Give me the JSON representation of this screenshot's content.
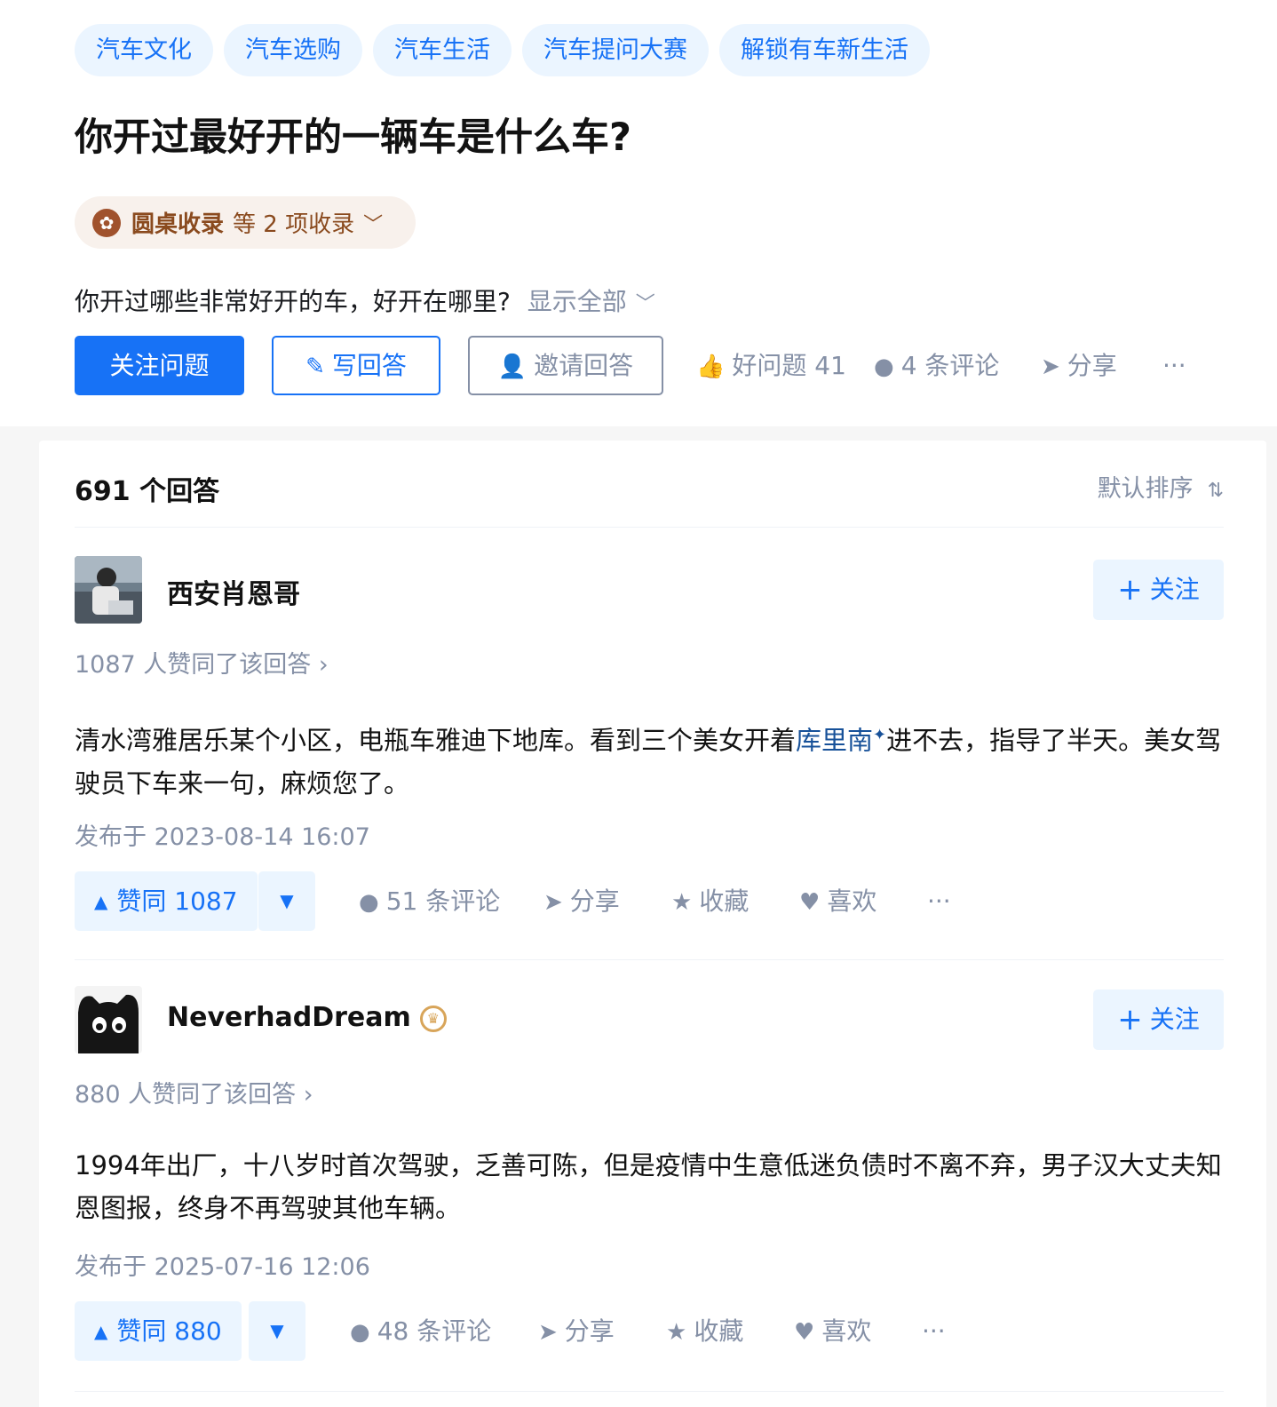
{
  "topics": [
    "汽车文化",
    "汽车选购",
    "汽车生活",
    "汽车提问大赛",
    "解锁有车新生活"
  ],
  "question": {
    "title": "你开过最好开的一辆车是什么车?",
    "collection": {
      "main": "圆桌收录",
      "rest": "等 2 项收录"
    },
    "detail": "你开过哪些非常好开的车，好开在哪里?",
    "show_all": "显示全部"
  },
  "actions": {
    "follow": "关注问题",
    "write": "写回答",
    "invite": "邀请回答",
    "good_question": "好问题 41",
    "comments": "4 条评论",
    "share": "分享",
    "more": "···"
  },
  "list": {
    "count": "691 个回答",
    "sort": "默认排序"
  },
  "answers": [
    {
      "author": "西安肖恩哥",
      "follow": "关注",
      "upvote_info": "1087 人赞同了该回答 ›",
      "content_before": "清水湾雅居乐某个小区，电瓶车雅迪下地库。看到三个美女开着",
      "content_link": "库里南",
      "content_after": "进不去，指导了半天。美女驾驶员下车来一句，麻烦您了。",
      "published": "发布于 2023-08-14 16:07",
      "vote": "赞同 1087",
      "comments": "51 条评论",
      "share": "分享",
      "collect": "收藏",
      "like": "喜欢",
      "more": "···"
    },
    {
      "author": "NeverhadDream",
      "follow": "关注",
      "upvote_info": "880 人赞同了该回答 ›",
      "content": "1994年出厂，十八岁时首次驾驶，乏善可陈，但是疫情中生意低迷负债时不离不弃，男子汉大丈夫知恩图报，终身不再驾驶其他车辆。",
      "published": "发布于 2025-07-16 12:06",
      "vote": "赞同 880",
      "comments": "48 条评论",
      "share": "分享",
      "collect": "收藏",
      "like": "喜欢",
      "more": "···"
    }
  ],
  "colors": {
    "brand": "#1772f6",
    "muted": "#8590a6",
    "link": "#175199",
    "badge": "#8a4a1e"
  }
}
